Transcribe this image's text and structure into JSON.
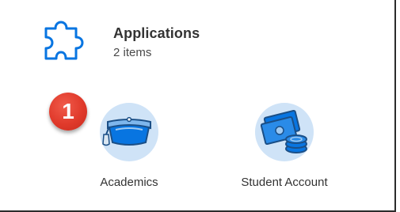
{
  "header": {
    "title": "Applications",
    "count_label": "2 items",
    "icon": "puzzle-icon"
  },
  "tiles": [
    {
      "label": "Academics",
      "icon": "graduation-cap-icon"
    },
    {
      "label": "Student Account",
      "icon": "money-coins-icon"
    }
  ],
  "callout": {
    "number": "1",
    "color": "#e03a2b"
  },
  "colors": {
    "icon_blue": "#0875e1",
    "icon_circle": "#cfe3f7",
    "text_dark": "#333333"
  }
}
